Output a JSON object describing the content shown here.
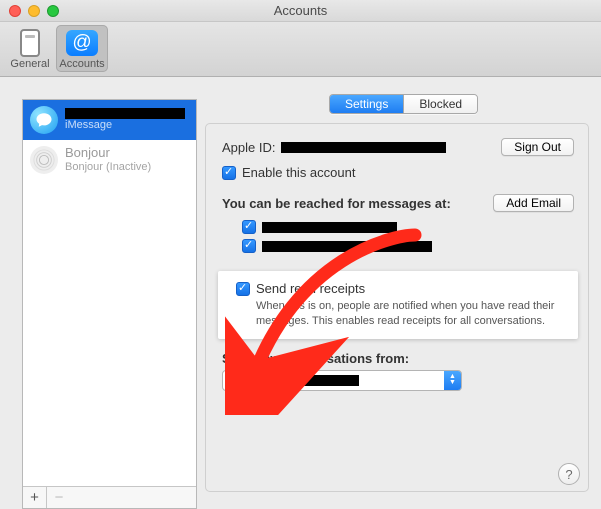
{
  "window": {
    "title": "Accounts"
  },
  "toolbar": {
    "general": "General",
    "accounts": "Accounts"
  },
  "sidebar": {
    "accounts": [
      {
        "title_redacted": true,
        "subtitle": "iMessage",
        "selected": true,
        "icon": "imessage-icon"
      },
      {
        "title": "Bonjour",
        "subtitle": "Bonjour (Inactive)",
        "selected": false,
        "icon": "bonjour-icon"
      }
    ],
    "add_symbol": "+",
    "remove_symbol": "−"
  },
  "segmented": {
    "settings": "Settings",
    "blocked": "Blocked"
  },
  "details": {
    "apple_id_label": "Apple ID:",
    "apple_id_value_redacted": true,
    "sign_out": "Sign Out",
    "enable_label": "Enable this account",
    "reach_heading": "You can be reached for messages at:",
    "add_email": "Add Email",
    "reach_items": [
      {
        "checked": true,
        "value_redacted": true
      },
      {
        "checked": true,
        "value_redacted": true
      }
    ],
    "read_receipts": {
      "label": "Send read receipts",
      "description": "When this is on, people are notified when you have read their messages. This enables read receipts for all conversations."
    },
    "start_from_label": "Start new conversations from:",
    "start_from_value_redacted": true,
    "help_symbol": "?"
  }
}
